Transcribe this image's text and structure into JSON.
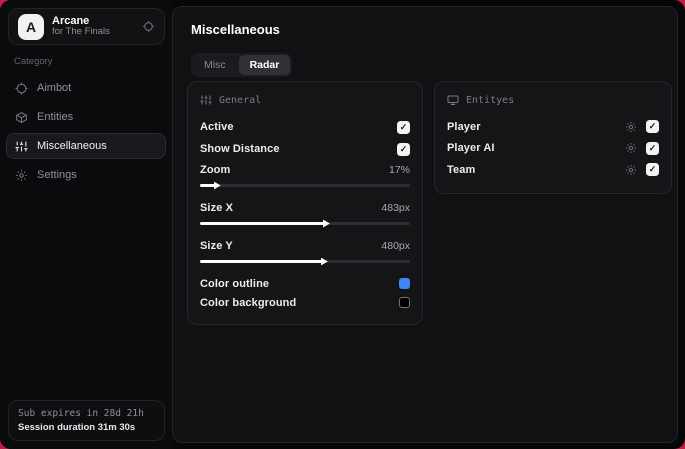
{
  "app": {
    "logo_letter": "A",
    "name": "Arcane",
    "subtitle": "for The Finals"
  },
  "sidebar": {
    "category_label": "Category",
    "items": [
      {
        "label": "Aimbot"
      },
      {
        "label": "Entities"
      },
      {
        "label": "Miscellaneous"
      },
      {
        "label": "Settings"
      }
    ],
    "footer": {
      "sub_expires": "Sub expires in 28d 21h",
      "session_duration": "Session duration 31m 30s"
    }
  },
  "main": {
    "title": "Miscellaneous",
    "tabs": [
      {
        "label": "Misc"
      },
      {
        "label": "Radar"
      }
    ],
    "active_tab": "Radar",
    "general": {
      "header": "General",
      "active": {
        "label": "Active",
        "checked": true
      },
      "show_distance": {
        "label": "Show Distance",
        "checked": true
      },
      "zoom": {
        "label": "Zoom",
        "value": "17%",
        "percent": 7
      },
      "size_x": {
        "label": "Size X",
        "value": "483px",
        "percent": 59
      },
      "size_y": {
        "label": "Size Y",
        "value": "480px",
        "percent": 58
      },
      "color_outline": {
        "label": "Color outline",
        "color": "#4285f4"
      },
      "color_background": {
        "label": "Color background",
        "color": "#000000"
      }
    },
    "entities": {
      "header": "Entityes",
      "rows": [
        {
          "label": "Player",
          "checked": true
        },
        {
          "label": "Player AI",
          "checked": true
        },
        {
          "label": "Team",
          "checked": true
        }
      ]
    }
  },
  "colors": {
    "accent_blue": "#4285f4",
    "backdrop_red": "#c11d47"
  }
}
